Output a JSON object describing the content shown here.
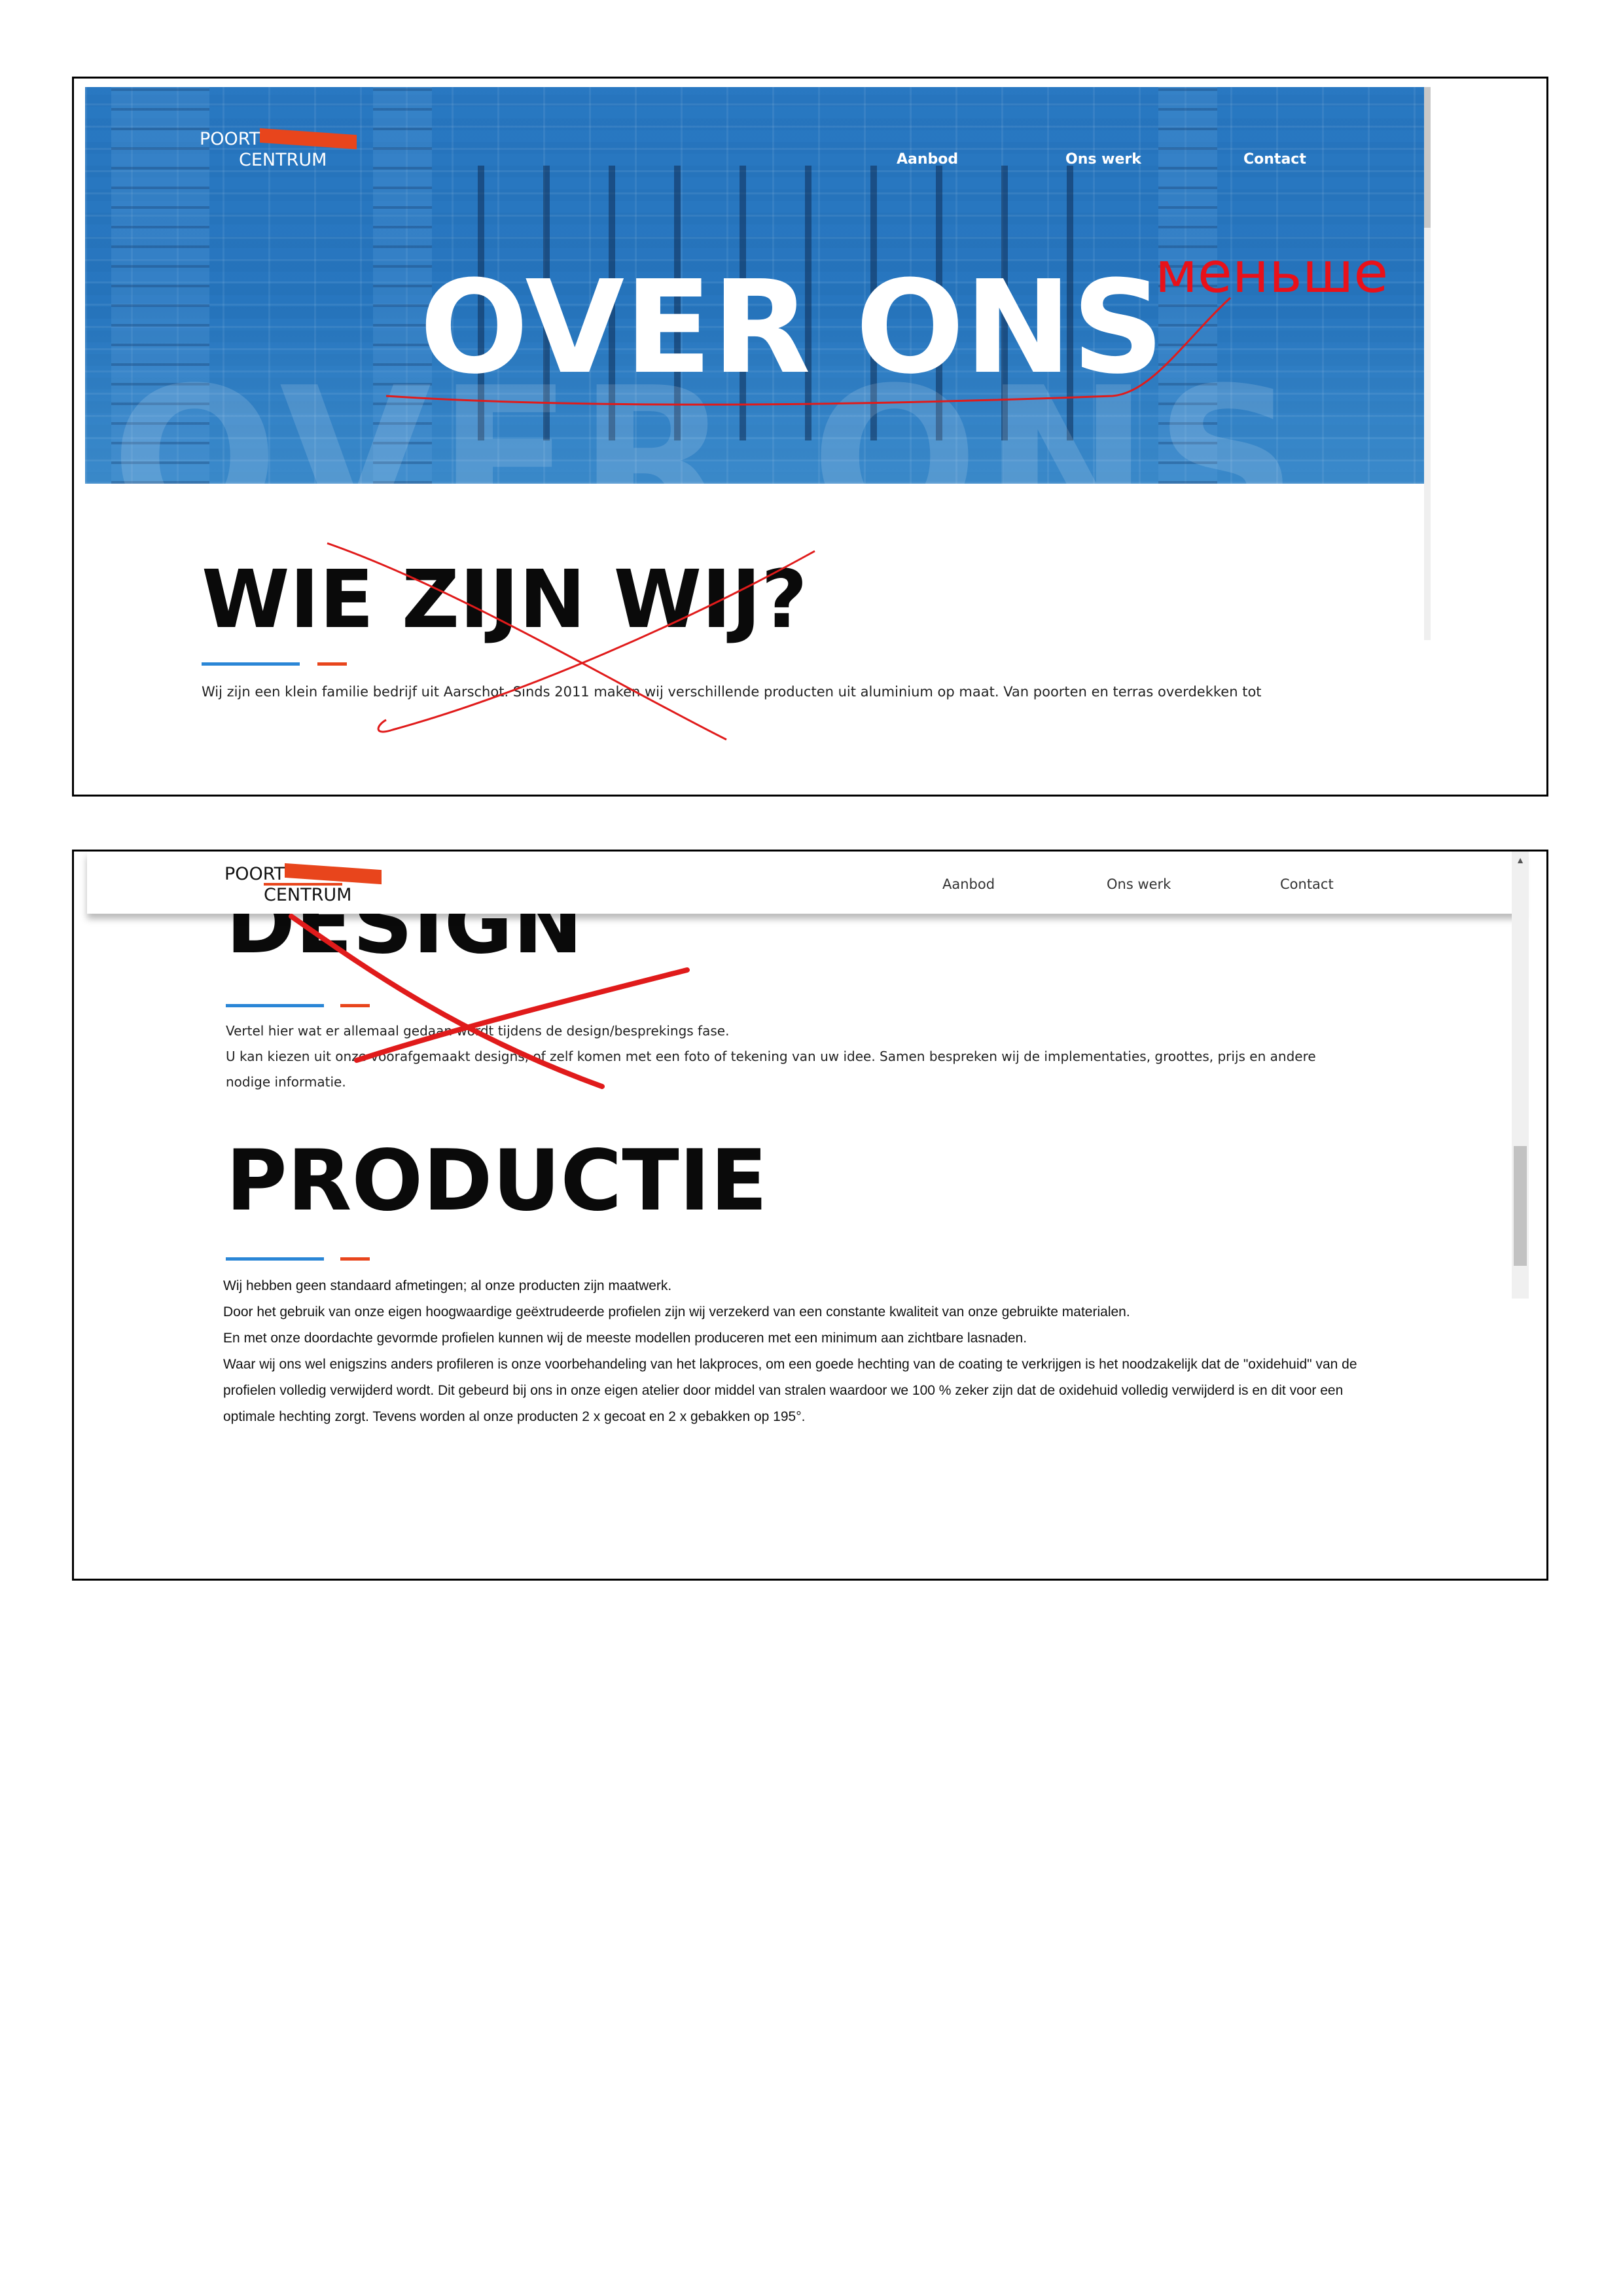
{
  "colors": {
    "accent_orange": "#e8451c",
    "accent_blue": "#2a86d6",
    "hero_blue": "#2a70b2",
    "annotation_red": "#e8111a"
  },
  "screen1": {
    "logo": {
      "line1": "POORT",
      "line2": "CENTRUM"
    },
    "nav": [
      "Aanbod",
      "Ons werk",
      "Contact"
    ],
    "hero": {
      "title": "OVER ONS",
      "ghost_title": "OVER ONS"
    },
    "annotation": "меньше",
    "section": {
      "heading": "WIE ZIJN WIJ?",
      "text": "Wij zijn een klein familie bedrijf uit Aarschot. Sinds 2011 maken wij verschillende producten uit aluminium op maat. Van poorten en terras overdekken tot"
    }
  },
  "screen2": {
    "logo": {
      "line1": "POORT",
      "line2": "CENTRUM"
    },
    "nav": [
      "Aanbod",
      "Ons werk",
      "Contact"
    ],
    "design": {
      "heading": "DESIGN",
      "lines": [
        "Vertel hier wat er allemaal gedaan wordt tijdens de design/besprekings fase.",
        "U kan kiezen uit onze voorafgemaakt designs, of zelf komen met een foto of tekening van uw idee. Samen bespreken wij de implementaties, groottes, prijs en andere",
        "nodige informatie."
      ]
    },
    "productie": {
      "heading": "PRODUCTIE",
      "lines": [
        "Wij hebben geen standaard afmetingen; al onze producten zijn maatwerk.",
        "Door het gebruik van onze eigen hoogwaardige geëxtrudeerde profielen zijn wij verzekerd van een constante kwaliteit van onze gebruikte materialen.",
        "En met onze doordachte gevormde profielen kunnen wij de meeste modellen produceren met een minimum aan zichtbare lasnaden.",
        "Waar wij ons wel enigszins anders profileren is onze voorbehandeling van het lakproces, om een goede hechting van de coating te verkrijgen is het noodzakelijk dat de \"oxidehuid\" van de",
        "profielen volledig verwijderd wordt. Dit gebeurd bij ons in onze eigen atelier door middel van stralen waardoor we 100 % zeker zijn dat de oxidehuid volledig verwijderd is en dit voor een",
        "optimale hechting zorgt. Tevens worden al onze producten 2 x gecoat en 2 x gebakken op 195°."
      ]
    }
  }
}
